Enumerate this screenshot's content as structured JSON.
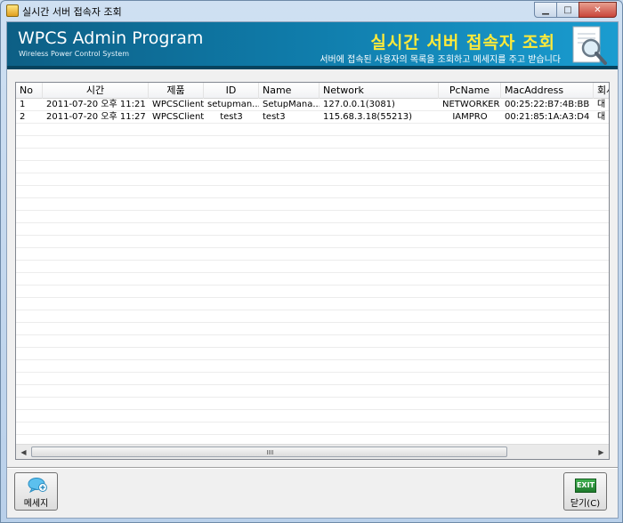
{
  "window": {
    "title": "실시간 서버 접속자 조회"
  },
  "banner": {
    "brand_title": "WPCS Admin Program",
    "brand_subtitle": "Wireless Power Control System",
    "heading": "실시간 서버 접속자 조회",
    "description": "서버에 접속된 사용자의 목록을 조회하고 메세지를 주고 받습니다"
  },
  "table": {
    "columns": [
      "No",
      "시간",
      "제품",
      "ID",
      "Name",
      "Network",
      "PcName",
      "MacAddress",
      "회사"
    ],
    "rows": [
      [
        "1",
        "2011-07-20 오후 11:21",
        "WPCSClient",
        "setupman...",
        "SetupMana...",
        "127.0.0.1(3081)",
        "NETWORKER",
        "00:25:22:B7:4B:BB",
        "대"
      ],
      [
        "2",
        "2011-07-20 오후 11:27",
        "WPCSClient",
        "test3",
        "test3",
        "115.68.3.18(55213)",
        "IAMPRO",
        "00:21:85:1A:A3:D4",
        "대"
      ]
    ]
  },
  "buttons": {
    "message_label": "메세지",
    "close_label": "닫기(C)",
    "exit_icon_text": "EXIT"
  },
  "colors": {
    "banner_start": "#0d5f85",
    "banner_end": "#1a9cd0",
    "heading_yellow": "#ffea3a"
  }
}
